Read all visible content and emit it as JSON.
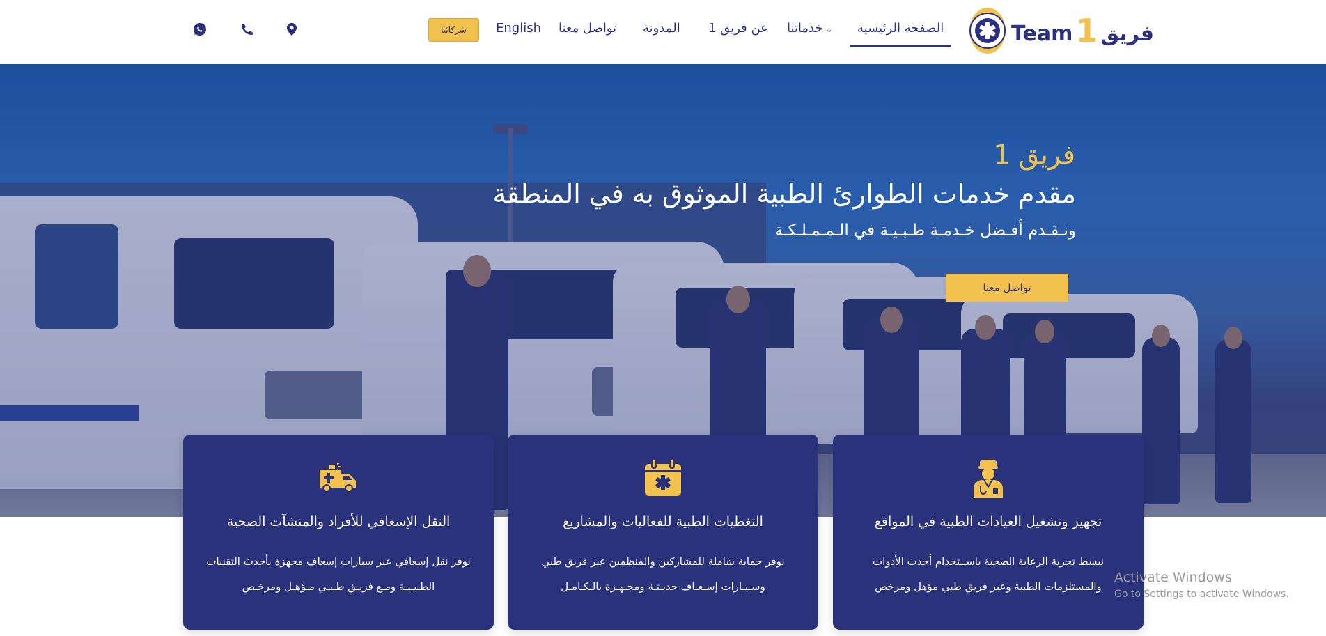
{
  "header": {
    "logo": {
      "en": "Team",
      "one": "1",
      "ar": "فريق"
    },
    "nav": {
      "home": "الصفحة الرئيسية",
      "services": "خدماتنا",
      "about": "عن فريق 1",
      "blog": "المدونة",
      "contact": "تواصل معنا",
      "english": "English",
      "partners": "شركائنا"
    },
    "icons": {
      "location": "map-pin-icon",
      "phone": "phone-icon",
      "whatsapp": "whatsapp-icon"
    }
  },
  "hero": {
    "brand": "فريق 1",
    "title": "مقدم خدمات الطوارئ الطبية الموثوق به في المنطقة",
    "subtitle": "ونـقـدم أفـضل خـدمـة طـبـيـة في الـمـمـلـكـة",
    "cta": "تواصل معنا"
  },
  "cards": [
    {
      "icon": "ambulance-icon",
      "title": "النقل الإسعافي للأفراد والمنشآت الصحية",
      "line1": "نوفر نقل إسعافي عبر سيارات إسعاف مجهزة بأحدث التقنيات",
      "line2": "الطـبـيـة ومـع فريـق طـبـي مـؤهـل ومرخـص"
    },
    {
      "icon": "calendar-medical-icon",
      "title": "التغطيات الطبية للفعاليات والمشاريع",
      "line1": "نوفر حماية شاملة للمشاركين والمنظمين عبر فريق طبي",
      "line2": "وسـيـارات إسـعـاف حديـثـة ومجـهـزة بالـكـامـل"
    },
    {
      "icon": "medic-icon",
      "title": "تجهيز وتشغيل العيادات الطبية في المواقع",
      "line1": "نبسط تجربة الرعاية الصحية باســتخدام أحدث الأدوات",
      "line2": "والمستلزمات الطبية وعبر فريق طبي مؤهل ومرخص"
    }
  ],
  "watermark": {
    "title": "Activate Windows",
    "subtitle": "Go to Settings to activate Windows."
  },
  "colors": {
    "navy": "#29327a",
    "yellow": "#f2c14e",
    "white": "#ffffff"
  }
}
